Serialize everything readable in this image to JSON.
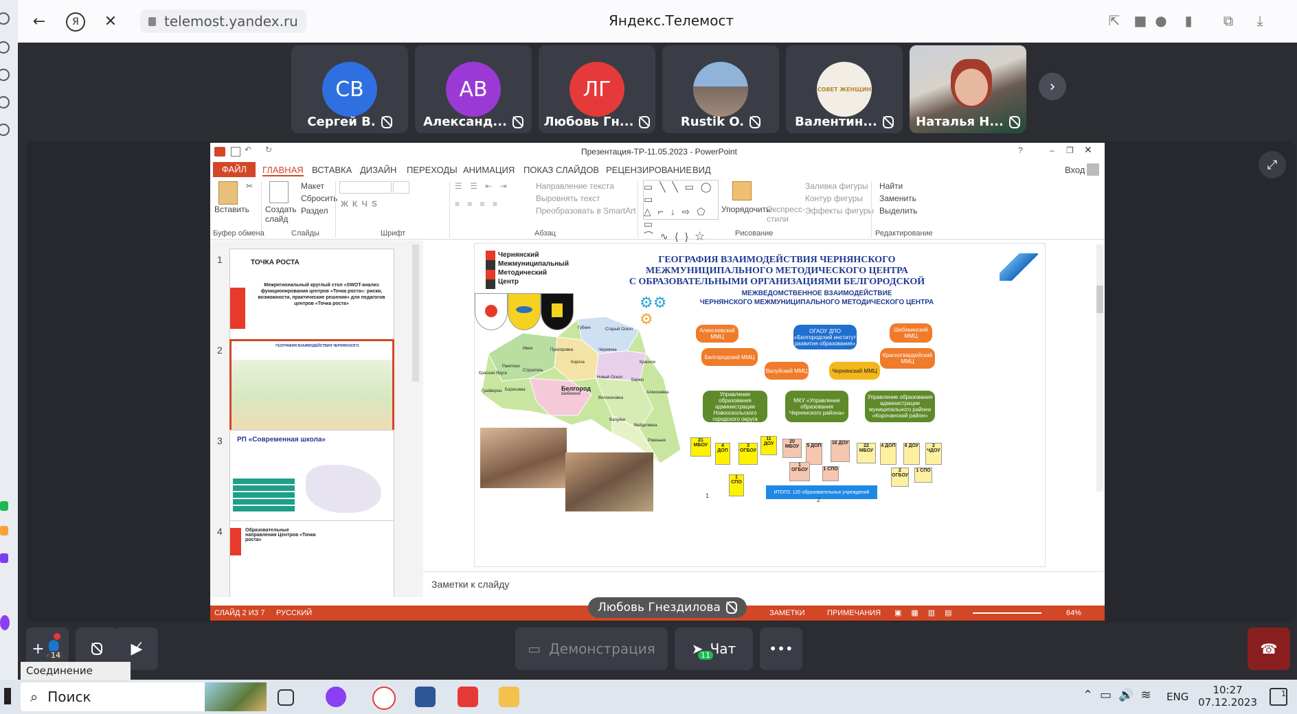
{
  "browser": {
    "url": "telemost.yandex.ru",
    "page_title": "Яндекс.Телемост"
  },
  "participants": [
    {
      "initials": "СВ",
      "name": "Сергей В.",
      "color": "#2f6fe0"
    },
    {
      "initials": "АВ",
      "name": "Александ...",
      "color": "#9b39d6"
    },
    {
      "initials": "ЛГ",
      "name": "Любовь Гн...",
      "color": "#e5393a"
    },
    {
      "initials": "",
      "name": "Rustik O.",
      "color": "#6b7a8f"
    },
    {
      "initials": "",
      "name": "Валентин...",
      "color": "#f2eee6",
      "logo_text": "СОВЕТ ЖЕНЩИН"
    },
    {
      "initials": "",
      "name": "Наталья Н...",
      "color": "#6a5a52"
    }
  ],
  "powerpoint": {
    "window_title": "Презентация-ТР-11.05.2023 - PowerPoint",
    "login": "Вход",
    "tabs": [
      "ФАЙЛ",
      "ГЛАВНАЯ",
      "ВСТАВКА",
      "ДИЗАЙН",
      "ПЕРЕХОДЫ",
      "АНИМАЦИЯ",
      "ПОКАЗ СЛАЙДОВ",
      "РЕЦЕНЗИРОВАНИЕ",
      "ВИД"
    ],
    "ribbon": {
      "paste": "Вставить",
      "create_slide": "Создать слайд",
      "layout": "Макет",
      "reset": "Сбросить",
      "section": "Раздел",
      "text_direction": "Направление текста",
      "align_text": "Выровнять текст",
      "smartart": "Преобразовать в SmartArt",
      "arrange": "Упорядочить",
      "quick_styles": "Экспресс-стили",
      "shape_fill": "Заливка фигуры",
      "shape_outline": "Контур фигуры",
      "shape_effects": "Эффекты фигуры",
      "find": "Найти",
      "replace": "Заменить",
      "select": "Выделить",
      "groups": [
        "Буфер обмена",
        "Слайды",
        "Шрифт",
        "Абзац",
        "Рисование",
        "Редактирование"
      ]
    },
    "thumbnails": [
      {
        "num": "1",
        "title": "Межрегиональный круглый стол «SWOT-анализ функционирования центров «Точка роста»: риски, возможности, практические решения» для педагогов центров «Точка роста»",
        "logo": "ТОЧКА РОСТА"
      },
      {
        "num": "2",
        "title": "ГЕОГРАФИЯ ВЗАИМОДЕЙСТВИЯ ЧЕРНЯНСКОГО"
      },
      {
        "num": "3",
        "title": "РП «Современная школа»"
      },
      {
        "num": "4",
        "title": "Образовательные направления Центров «Точка роста»"
      }
    ],
    "slide": {
      "title_lines": [
        "ГЕОГРАФИЯ ВЗАИМОДЕЙСТВИЯ ЧЕРНЯНСКОГО",
        "МЕЖМУНИЦИПАЛЬНОГО МЕТОДИЧЕСКОГО ЦЕНТРА",
        "С ОБРАЗОВАТЕЛЬНЫМИ ОРГАНИЗАЦИЯМИ БЕЛГОРОДСКОЙ"
      ],
      "logo_lines": [
        "Чернянский",
        "Межмуниципальный",
        "Методический",
        "Центр"
      ],
      "inner_title_lines": [
        "МЕЖВЕДОМСТВЕННОЕ ВЗАИМОДЕЙСТВИЕ",
        "ЧЕРНЯНСКОГО МЕЖМУНИЦИПАЛЬНОГО МЕТОДИЧЕСКОГО ЦЕНТРА"
      ],
      "map_labels": [
        "Губкин",
        "Старый Оскол",
        "Чернянка",
        "Красное",
        "Ивня",
        "Прохоровка",
        "Корочa",
        "Ракитное",
        "Строитель",
        "Белгород",
        "Новый Оскол",
        "Бирюч",
        "Красная Яруга",
        "Борисовка",
        "Шебекино",
        "Волоконовка",
        "Алексеевка",
        "Грайворон",
        "Валуйки",
        "Вейделевка",
        "Ровеньки"
      ],
      "org_boxes": {
        "center": "ОГАОУ ДПО «Белгородский институт развития образования»",
        "alekseevsky": "Алексеевский ММЦ",
        "belgorod": "Белгородский ММЦ",
        "valuysky": "Валуйский ММЦ",
        "chernyansky": "Чернянский ММЦ",
        "shebekinsky": "Шебекинский ММЦ",
        "krasnogvard": "Красногвардейский ММЦ",
        "uo_novoosk": "Управление образования администрации Новооскольского городского округа",
        "mku_chern": "МКУ «Управление образования Чернянского района»",
        "uo_korocha": "Управление образования администрации муниципального района «Корочанский район»",
        "total": "ИТОГО: 120 образовательных учреждений"
      },
      "stats": [
        "21 МБОУ",
        "4 ДОП",
        "3 ОГБОУ",
        "11 ДОУ",
        "1 СПО",
        "20 МБОУ",
        "5 ДОП",
        "16 ДОУ",
        "1 ОГБОУ",
        "1 СПО",
        "22 МБОУ",
        "4 ДОП",
        "6 ДОУ",
        "2 ЧДОУ",
        "2 ОГБОУ",
        "1 СПО"
      ],
      "page_marker": "1",
      "bottom_marker": "2"
    },
    "notes_placeholder": "Заметки к слайду",
    "status": {
      "slide_info": "СЛАЙД 2 ИЗ 7",
      "language": "РУССКИЙ",
      "notes": "ЗАМЕТКИ",
      "comments": "ПРИМЕЧАНИЯ",
      "zoom": "64%"
    }
  },
  "speaker": {
    "name": "Любовь Гнездилова"
  },
  "toolbar": {
    "participants_count": "14",
    "demo_label": "Демонстрация",
    "chat_label": "Чат",
    "chat_badge": "11",
    "more": "•••",
    "tooltip": "Соединение"
  },
  "taskbar": {
    "search_label": "Поиск",
    "language": "ENG",
    "time": "10:27",
    "date": "07.12.2023",
    "notif_count": "1"
  }
}
